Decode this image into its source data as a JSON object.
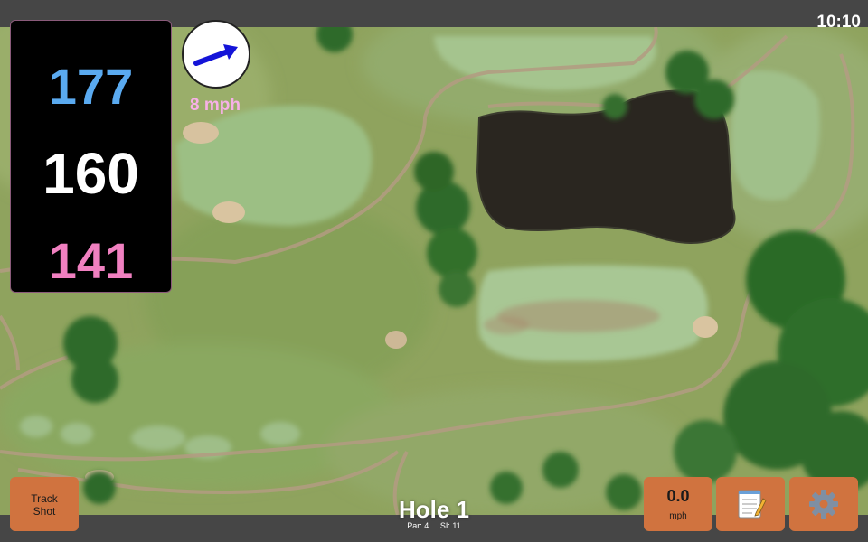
{
  "status_bar": {
    "time": "10:10"
  },
  "distances": {
    "back": "177",
    "middle": "160",
    "front": "141"
  },
  "wind": {
    "speed_label": "8 mph",
    "direction_icon": "arrow-icon"
  },
  "track_shot": {
    "line1": "Track",
    "line2": "Shot"
  },
  "speed": {
    "value": "0.0",
    "unit": "mph"
  },
  "notes_button": {
    "icon": "notepad-icon"
  },
  "settings_button": {
    "icon": "gear-icon"
  },
  "hole": {
    "title": "Hole 1",
    "par": "Par: 4",
    "si": "SI: 11"
  },
  "colors": {
    "back_distance": "#5aaaf0",
    "middle_distance": "#ffffff",
    "front_distance": "#f080c0",
    "wind_text": "#f8b0e8",
    "button": "#d0733f",
    "bar": "#464646"
  }
}
